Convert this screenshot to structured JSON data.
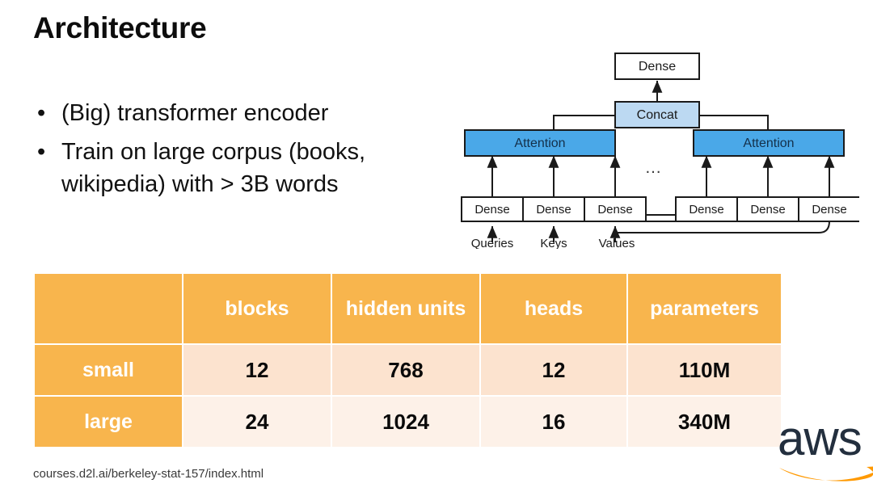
{
  "slide": {
    "title": "Architecture",
    "footer_url": "courses.d2l.ai/berkeley-stat-157/index.html",
    "bullet_marker": "•"
  },
  "bullets": [
    {
      "text": "(Big) transformer encoder"
    },
    {
      "text": "Train on large corpus (books, wikipedia) with > 3B words"
    }
  ],
  "diagram": {
    "name": "multi-head-attention",
    "top_box": "Dense",
    "concat_box": "Concat",
    "attention_left": "Attention",
    "attention_right": "Attention",
    "ellipsis": "…",
    "dense_left": [
      "Dense",
      "Dense",
      "Dense"
    ],
    "dense_right": [
      "Dense",
      "Dense",
      "Dense"
    ],
    "inputs": [
      "Queries",
      "Keys",
      "Values"
    ],
    "colors": {
      "attention_fill": "#4aa8e8",
      "concat_fill": "#bcd9f2",
      "box_stroke": "#1a1a1a",
      "box_fill": "#ffffff"
    }
  },
  "table": {
    "corner_label": "",
    "columns": [
      "blocks",
      "hidden units",
      "heads",
      "parameters"
    ],
    "rows": [
      {
        "label": "small",
        "blocks": "12",
        "hidden_units": "768",
        "heads": "12",
        "parameters": "110M"
      },
      {
        "label": "large",
        "blocks": "24",
        "hidden_units": "1024",
        "heads": "16",
        "parameters": "340M"
      }
    ],
    "colors": {
      "header_bg": "#f8b54d",
      "row_label_bg": "#f8b54d",
      "row1_bg": "#fce3cf",
      "row2_bg": "#fdf1e8",
      "header_text": "#ffffff",
      "cell_text": "#0a0a0a"
    }
  },
  "logo": {
    "name": "aws-logo",
    "wordmark": "aws",
    "text_color": "#232f3e",
    "arrow_color": "#ff9900"
  }
}
